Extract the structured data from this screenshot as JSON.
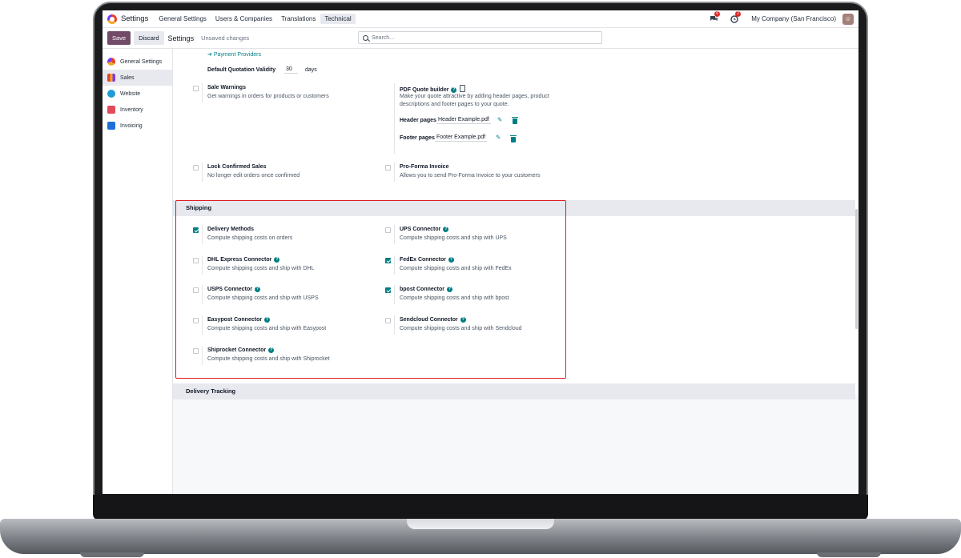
{
  "navbar": {
    "app_title": "Settings",
    "menus": [
      "General Settings",
      "Users & Companies",
      "Translations",
      "Technical"
    ],
    "active_menu": "Technical",
    "chat_badge": "6",
    "activity_badge": "2",
    "company": "My Company (San Francisco)"
  },
  "control_panel": {
    "save_label": "Save",
    "discard_label": "Discard",
    "title": "Settings",
    "status": "Unsaved changes",
    "search_placeholder": "Search..."
  },
  "sidebar": {
    "items": [
      {
        "label": "General Settings",
        "color": "#e8412b",
        "active": false
      },
      {
        "label": "Sales",
        "color": "#e8412b",
        "active": true
      },
      {
        "label": "Website",
        "color": "#1f9bd6",
        "active": false
      },
      {
        "label": "Inventory",
        "color": "#e24b5a",
        "active": false
      },
      {
        "label": "Invoicing",
        "color": "#1f6fd6",
        "active": false
      }
    ]
  },
  "quotations": {
    "payment_providers_link": "Payment Providers",
    "validity_label": "Default Quotation Validity",
    "validity_value": "30",
    "validity_unit": "days",
    "sale_warnings": {
      "title": "Sale Warnings",
      "desc": "Get warnings in orders for products or customers",
      "checked": false
    },
    "pdf_builder": {
      "title": "PDF Quote builder",
      "desc_line1": "Make your quote attractive by adding header pages, product",
      "desc_line2": "descriptions and footer pages to your quote.",
      "header_label": "Header pages",
      "header_file": "Header Example.pdf",
      "footer_label": "Footer pages",
      "footer_file": "Footer Example.pdf"
    },
    "lock_confirmed": {
      "title": "Lock Confirmed Sales",
      "desc": "No longer edit orders once confirmed",
      "checked": false
    },
    "proforma": {
      "title": "Pro-Forma Invoice",
      "desc": "Allows you to send Pro-Forma Invoice to your customers",
      "checked": false
    }
  },
  "shipping": {
    "section_title": "Shipping",
    "items": [
      {
        "title": "Delivery Methods",
        "desc": "Compute shipping costs on orders",
        "checked": true,
        "help": false
      },
      {
        "title": "UPS Connector",
        "desc": "Compute shipping costs and ship with UPS",
        "checked": false,
        "help": true
      },
      {
        "title": "DHL Express Connector",
        "desc": "Compute shipping costs and ship with DHL",
        "checked": false,
        "help": true
      },
      {
        "title": "FedEx Connector",
        "desc": "Compute shipping costs and ship with FedEx",
        "checked": true,
        "help": true
      },
      {
        "title": "USPS Connector",
        "desc": "Compute shipping costs and ship with USPS",
        "checked": false,
        "help": true
      },
      {
        "title": "bpost Connector",
        "desc": "Compute shipping costs and ship with bpost",
        "checked": true,
        "help": true
      },
      {
        "title": "Easypost Connector",
        "desc": "Compute shipping costs and ship with Easypost",
        "checked": false,
        "help": true
      },
      {
        "title": "Sendcloud Connector",
        "desc": "Compute shipping costs and ship with Sendcloud",
        "checked": false,
        "help": true
      },
      {
        "title": "Shiprocket Connector",
        "desc": "Compute shipping costs and ship with Shiprocket",
        "checked": false,
        "help": true
      }
    ]
  },
  "delivery_tracking": {
    "section_title": "Delivery Tracking"
  },
  "colors": {
    "brand": "#714b67",
    "accent": "#017e84",
    "highlight": "#e01b24"
  }
}
